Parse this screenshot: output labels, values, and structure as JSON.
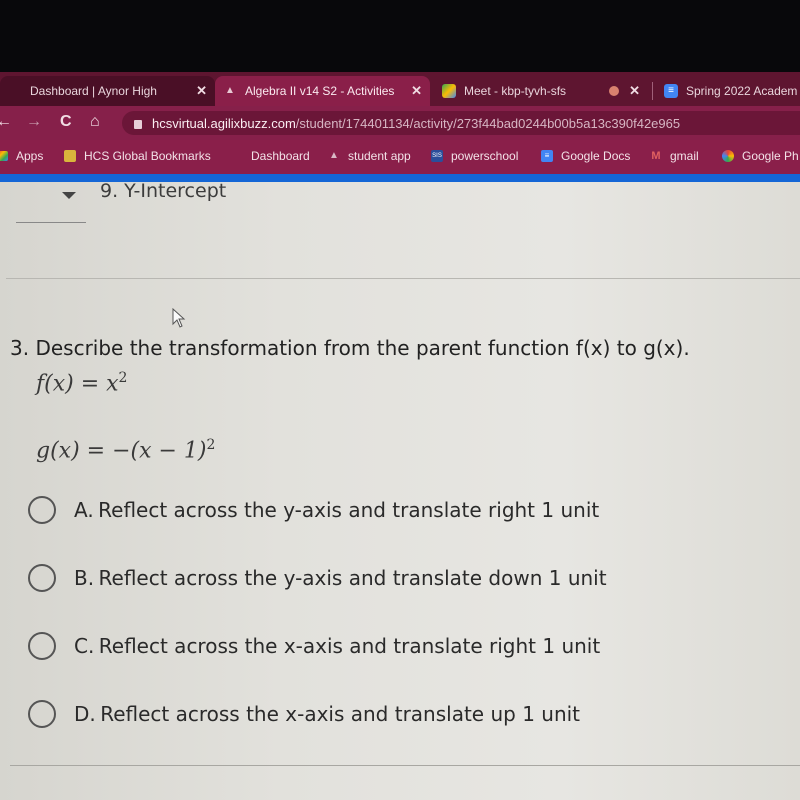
{
  "browser": {
    "tabs": [
      {
        "title": "Dashboard | Aynor High",
        "close": "✕",
        "state": "inactive"
      },
      {
        "title": "Algebra II v14 S2 - Activities",
        "close": "✕",
        "state": "active"
      },
      {
        "title": "Meet - kbp-tyvh-sfs",
        "close": "✕",
        "state": "inactive"
      },
      {
        "title": "Spring 2022 Academ",
        "state": "inactive"
      }
    ],
    "nav": {
      "back": "←",
      "forward": "→",
      "reload": "C",
      "home": "⌂"
    },
    "url": {
      "host": "hcsvirtual.agilixbuzz.com",
      "path": "/student/174401134/activity/273f44bad0244b00b5a13c390f42e965"
    },
    "bookmarks": [
      {
        "label": "Apps"
      },
      {
        "label": "HCS Global Bookmarks"
      },
      {
        "label": "Dashboard"
      },
      {
        "label": "student app"
      },
      {
        "label": "powerschool",
        "icon_text": "SIS"
      },
      {
        "label": "Google Docs"
      },
      {
        "label": "gmail",
        "icon_text": "M"
      },
      {
        "label": "Google Ph"
      }
    ],
    "accent_colors": {
      "tabbar": "#5e1530",
      "toolbar": "#86204a",
      "progress": "#1466d6"
    }
  },
  "page": {
    "previous_item": "9.  Y-Intercept",
    "question": {
      "number": "3.",
      "prompt": "Describe the transformation from the parent function f(x) to g(x).",
      "f_lhs": "f(x) = x",
      "f_exp": "2",
      "g_lhs": "g(x) = −(x − 1)",
      "g_exp": "2"
    },
    "options": [
      {
        "letter": "A.",
        "text": "Reflect across the y-axis and translate right 1 unit",
        "selected": false
      },
      {
        "letter": "B.",
        "text": "Reflect across the y-axis and translate down 1 unit",
        "selected": false
      },
      {
        "letter": "C.",
        "text": "Reflect across the x-axis and translate right 1 unit",
        "selected": false
      },
      {
        "letter": "D.",
        "text": "Reflect across the x-axis and translate up 1 unit",
        "selected": false
      }
    ]
  }
}
